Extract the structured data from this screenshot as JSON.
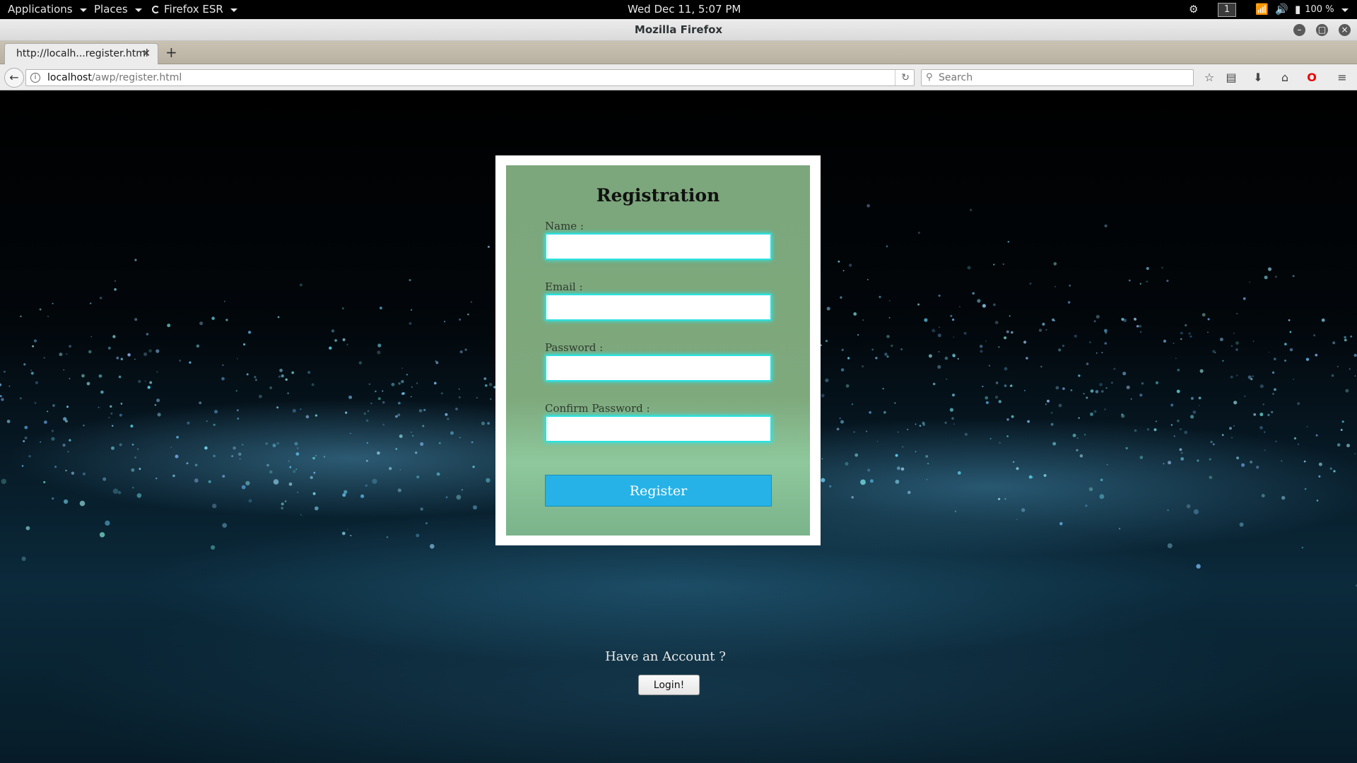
{
  "top_bar": {
    "applications": "Applications",
    "places": "Places",
    "browser_menu": "Firefox ESR",
    "clock": "Wed Dec 11,  5:07 PM",
    "workspace": "1",
    "battery": "100 %"
  },
  "window": {
    "title": "Mozilla Firefox"
  },
  "tabs": [
    {
      "label": "http://localh...register.html"
    }
  ],
  "navbar": {
    "url_host": "localhost",
    "url_path": "/awp/register.html",
    "search_placeholder": "Search"
  },
  "form": {
    "title": "Registration",
    "fields": [
      {
        "label": "Name :",
        "value": ""
      },
      {
        "label": "Email :",
        "value": ""
      },
      {
        "label": "Password :",
        "value": ""
      },
      {
        "label": "Confirm Password :",
        "value": ""
      }
    ],
    "submit_label": "Register"
  },
  "login_prompt": {
    "text": "Have an Account ?",
    "button_label": "Login!"
  },
  "colors": {
    "form_background": "#7ca67b",
    "input_glow": "#2de0e0",
    "register_button": "#26b2e6"
  }
}
